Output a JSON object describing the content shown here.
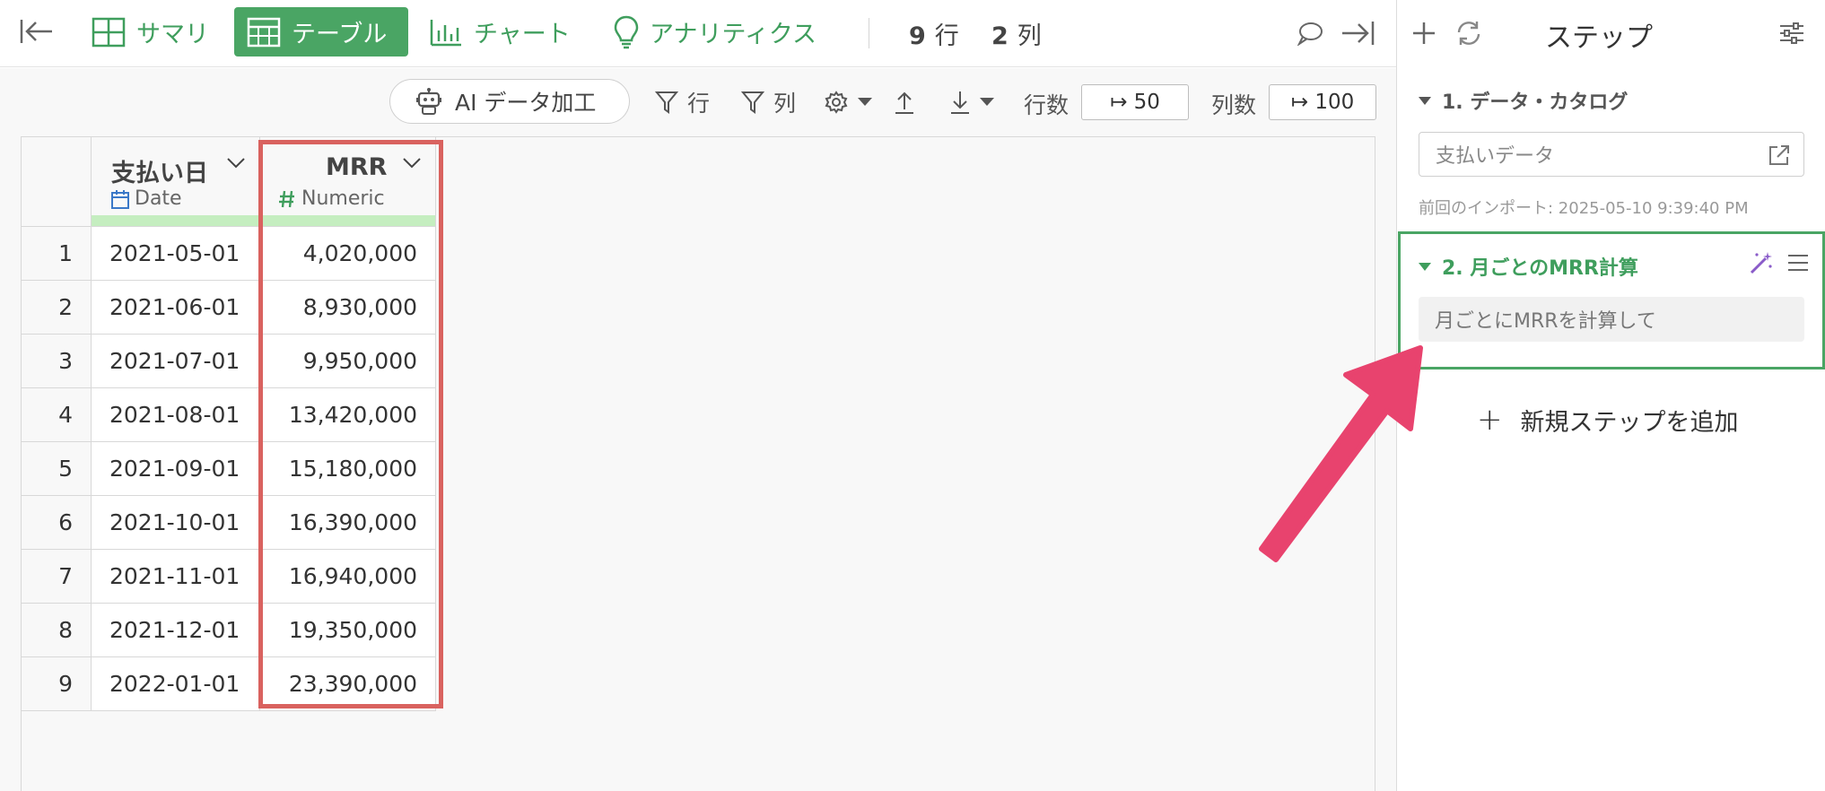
{
  "toolbar": {
    "tabs": [
      {
        "label": "サマリ",
        "icon": "summary-grid-icon"
      },
      {
        "label": "テーブル",
        "icon": "table-icon",
        "active": true
      },
      {
        "label": "チャート",
        "icon": "chart-icon"
      },
      {
        "label": "アナリティクス",
        "icon": "lightbulb-icon"
      }
    ],
    "rows_count": "9",
    "rows_unit": "行",
    "cols_count": "2",
    "cols_unit": "列"
  },
  "subbar": {
    "ai_label": "AI データ加工",
    "row_filter": "行",
    "col_filter": "列",
    "row_count_label": "行数",
    "row_count_value": "↦ 50",
    "col_count_label": "列数",
    "col_count_value": "↦ 100"
  },
  "table": {
    "columns": [
      {
        "name": "支払い日",
        "type": "Date"
      },
      {
        "name": "MRR",
        "type": "Numeric"
      }
    ],
    "rows": [
      {
        "n": "1",
        "date": "2021-05-01",
        "mrr": "4,020,000"
      },
      {
        "n": "2",
        "date": "2021-06-01",
        "mrr": "8,930,000"
      },
      {
        "n": "3",
        "date": "2021-07-01",
        "mrr": "9,950,000"
      },
      {
        "n": "4",
        "date": "2021-08-01",
        "mrr": "13,420,000"
      },
      {
        "n": "5",
        "date": "2021-09-01",
        "mrr": "15,180,000"
      },
      {
        "n": "6",
        "date": "2021-10-01",
        "mrr": "16,390,000"
      },
      {
        "n": "7",
        "date": "2021-11-01",
        "mrr": "16,940,000"
      },
      {
        "n": "8",
        "date": "2021-12-01",
        "mrr": "19,350,000"
      },
      {
        "n": "9",
        "date": "2022-01-01",
        "mrr": "23,390,000"
      }
    ]
  },
  "panel": {
    "title": "ステップ",
    "step1": {
      "title": "1. データ・カタログ",
      "source": "支払いデータ",
      "import_note": "前回のインポート: 2025-05-10 9:39:40 PM"
    },
    "step2": {
      "title": "2. 月ごとのMRR計算",
      "prompt": "月ごとにMRRを計算して"
    },
    "add_step": "新規ステップを追加"
  },
  "colors": {
    "accent_green": "#4aa564",
    "highlight_red": "#d9625f",
    "arrow_pink": "#e8436e"
  }
}
